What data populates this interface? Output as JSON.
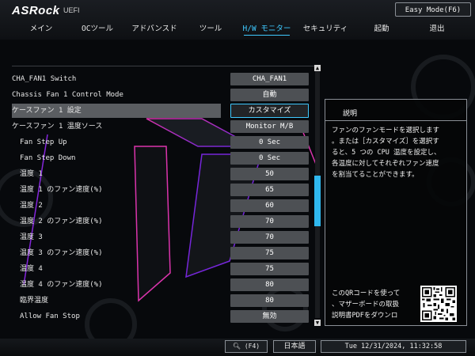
{
  "brand": {
    "logo": "ASRock",
    "subtitle": "UEFI"
  },
  "header": {
    "easy_mode_label": "Easy Mode(F6)"
  },
  "tabs": [
    {
      "label": "メイン"
    },
    {
      "label": "OCツール"
    },
    {
      "label": "アドバンスド"
    },
    {
      "label": "ツール"
    },
    {
      "label": "H/W モニター",
      "active": true
    },
    {
      "label": "セキュリティ"
    },
    {
      "label": "起動"
    },
    {
      "label": "退出"
    }
  ],
  "settings": [
    {
      "label": "CHA_FAN1 Switch",
      "value": "CHA_FAN1",
      "indent": false
    },
    {
      "label": "Chassis Fan 1 Control Mode",
      "value": "自動",
      "indent": false
    },
    {
      "label": "ケースファン 1 設定",
      "value": "カスタマイズ",
      "indent": false,
      "selected": true
    },
    {
      "label": "ケースファン 1 温度ソース",
      "value": "Monitor M/B",
      "indent": false
    },
    {
      "label": "Fan Step Up",
      "value": "0 Sec",
      "indent": true
    },
    {
      "label": "Fan Step Down",
      "value": "0 Sec",
      "indent": true
    },
    {
      "label": "温度 1",
      "value": "50",
      "indent": true
    },
    {
      "label": "温度 1 のファン速度(%)",
      "value": "65",
      "indent": true
    },
    {
      "label": "温度 2",
      "value": "60",
      "indent": true
    },
    {
      "label": "温度 2 のファン速度(%)",
      "value": "70",
      "indent": true
    },
    {
      "label": "温度 3",
      "value": "70",
      "indent": true
    },
    {
      "label": "温度 3 のファン速度(%)",
      "value": "75",
      "indent": true
    },
    {
      "label": "温度 4",
      "value": "75",
      "indent": true
    },
    {
      "label": "温度 4 のファン速度(%)",
      "value": "80",
      "indent": true
    },
    {
      "label": "臨界温度",
      "value": "80",
      "indent": true
    },
    {
      "label": "Allow Fan Stop",
      "value": "無効",
      "indent": true
    }
  ],
  "description": {
    "title": "説明",
    "lines": [
      "ファンのファンモードを選択します",
      "。または［カスタマイズ］を選択す",
      "ると、5 つの CPU 温度を設定し、",
      "各温度に対してそれぞれファン速度",
      "を割当てることができます。"
    ],
    "qr_lines": [
      "このQRコードを使って",
      "、マザーボードの取扱",
      "説明書PDFをダウンロ"
    ]
  },
  "footer": {
    "search_label": "(F4)",
    "language_label": "日本語",
    "datetime": "Tue 12/31/2024, 11:32:58"
  },
  "colors": {
    "accent": "#3fc9ff",
    "value_box": "#4d5054",
    "highlight_row": "#5a5d61"
  },
  "icons": [
    "search-icon",
    "scroll-up-arrow-icon",
    "scroll-down-arrow-icon",
    "qr-code-icon"
  ]
}
